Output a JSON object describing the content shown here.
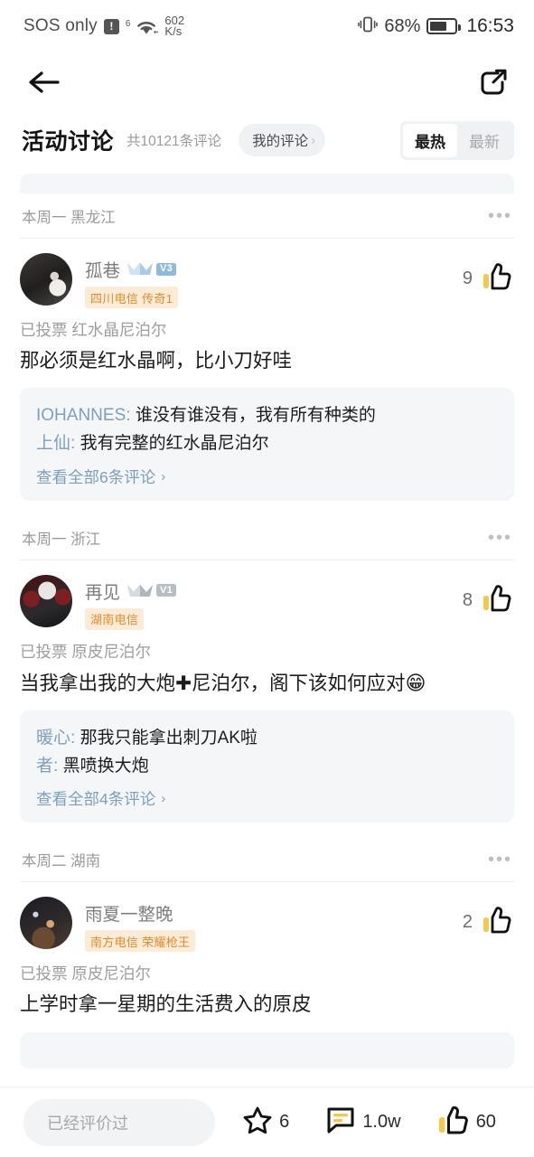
{
  "status_bar": {
    "carrier": "SOS only",
    "alert_icon": "!",
    "network_gen": "6",
    "speed_value": "602",
    "speed_unit": "K/s",
    "battery_percent": "68%",
    "time": "16:53"
  },
  "nav": {
    "back_icon": "back-arrow",
    "share_icon": "share"
  },
  "header": {
    "title": "活动讨论",
    "count_text": "共10121条评论",
    "my_comments_label": "我的评论",
    "chevron": "›",
    "sort_hot": "最热",
    "sort_new": "最新",
    "active_sort": "最热"
  },
  "comments": [
    {
      "meta": "本周一 黑龙江",
      "more": "•••",
      "username": "孤巷",
      "level": "V3",
      "level_color": "#8fb9dd",
      "has_crown": true,
      "crown_color": "#8fb9dd",
      "tag": "四川电信 传奇1",
      "like_count": "9",
      "voted_label": "已投票 红水晶尼泊尔",
      "body": "那必须是红水晶啊，比小刀好哇",
      "replies": [
        {
          "name": "IOHANNES:",
          "text": "谁没有谁没有，我有所有种类的"
        },
        {
          "name": "上仙:",
          "text": "我有完整的红水晶尼泊尔"
        }
      ],
      "view_all": "查看全部6条评论"
    },
    {
      "meta": "本周一 浙江",
      "more": "•••",
      "username": "再见",
      "level": "V1",
      "level_color": "#b9bcc0",
      "has_crown": true,
      "crown_color": "#b9bcc0",
      "tag": "湖南电信",
      "like_count": "8",
      "voted_label": "已投票 原皮尼泊尔",
      "body_part1": "当我拿出我的大炮",
      "body_plus": "✚",
      "body_part2": "尼泊尔，阁下该如何应对",
      "body_emoji": "😁",
      "replies": [
        {
          "name": "暖心:",
          "text": "那我只能拿出刺刀AK啦"
        },
        {
          "name": "者:",
          "text": "黑喷换大炮"
        }
      ],
      "view_all": "查看全部4条评论"
    },
    {
      "meta": "本周二 湖南",
      "more": "•••",
      "username": "雨夏一整晚",
      "level": "",
      "has_crown": false,
      "tag": "南方电信 荣耀枪王",
      "like_count": "2",
      "voted_label": "已投票 原皮尼泊尔",
      "body": "上学时拿一星期的生活费入的原皮",
      "replies": [],
      "view_all": ""
    }
  ],
  "bottom_bar": {
    "input_placeholder": "已经评价过",
    "favorite_count": "6",
    "comment_count": "1.0w",
    "like_count": "60"
  },
  "colors": {
    "accent_yellow": "#f2c94c",
    "link_blue": "#7d9fbf",
    "tag_orange": "#e08b2e",
    "tag_bg": "#fcecd7",
    "reply_bg": "#f5f6f7"
  }
}
